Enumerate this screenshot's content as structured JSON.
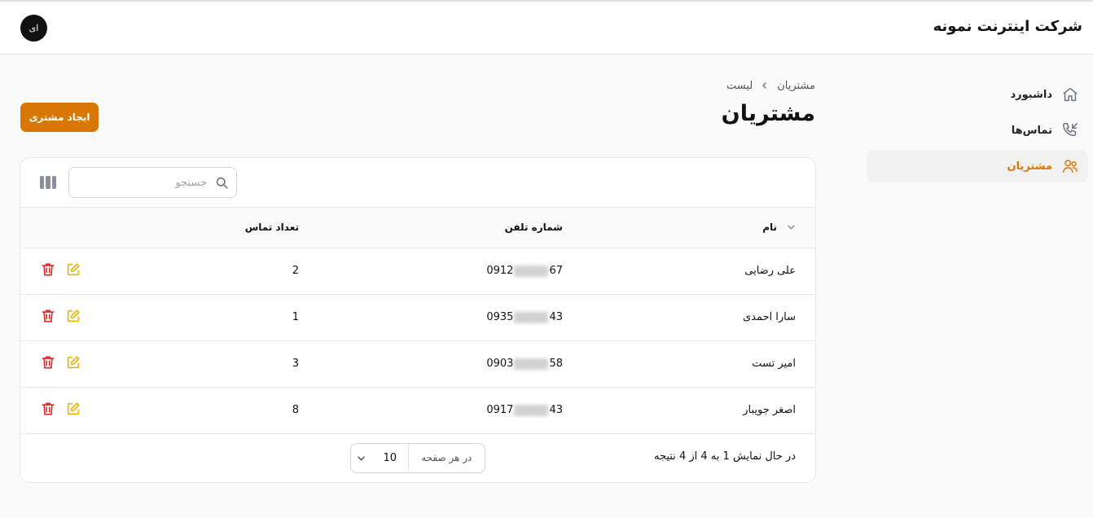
{
  "header": {
    "brand": "شرکت اینترنت نمونه",
    "avatar_initials": "ای"
  },
  "sidebar": {
    "items": [
      {
        "label": "داشبورد",
        "icon": "home-icon",
        "active": false
      },
      {
        "label": "تماس‌ها",
        "icon": "phone-incoming-icon",
        "active": false
      },
      {
        "label": "مشتریان",
        "icon": "users-icon",
        "active": true
      }
    ]
  },
  "breadcrumb": {
    "items": [
      "مشتریان",
      "لیست"
    ]
  },
  "page": {
    "title": "مشتریان",
    "create_label": "ایجاد مشتری"
  },
  "toolbar": {
    "search_placeholder": "جستجو",
    "columns_icon": "columns-icon"
  },
  "table": {
    "headers": {
      "name": "نام",
      "phone": "شماره تلفن",
      "count": "تعداد تماس"
    },
    "rows": [
      {
        "name": "علی رضایی",
        "phone_prefix": "0912",
        "phone_suffix": "67",
        "count": "2"
      },
      {
        "name": "سارا احمدی",
        "phone_prefix": "0935",
        "phone_suffix": "43",
        "count": "1"
      },
      {
        "name": "امیر تست",
        "phone_prefix": "0903",
        "phone_suffix": "58",
        "count": "3"
      },
      {
        "name": "اصغر جویبار",
        "phone_prefix": "0917",
        "phone_suffix": "43",
        "count": "8"
      }
    ]
  },
  "footer": {
    "summary": "در حال نمایش 1 به 4 از 4 نتیجه",
    "per_page_label": "در هر صفحه",
    "per_page_value": "10"
  },
  "colors": {
    "accent": "#d97706",
    "danger": "#dc2626",
    "edit": "#eab308"
  }
}
